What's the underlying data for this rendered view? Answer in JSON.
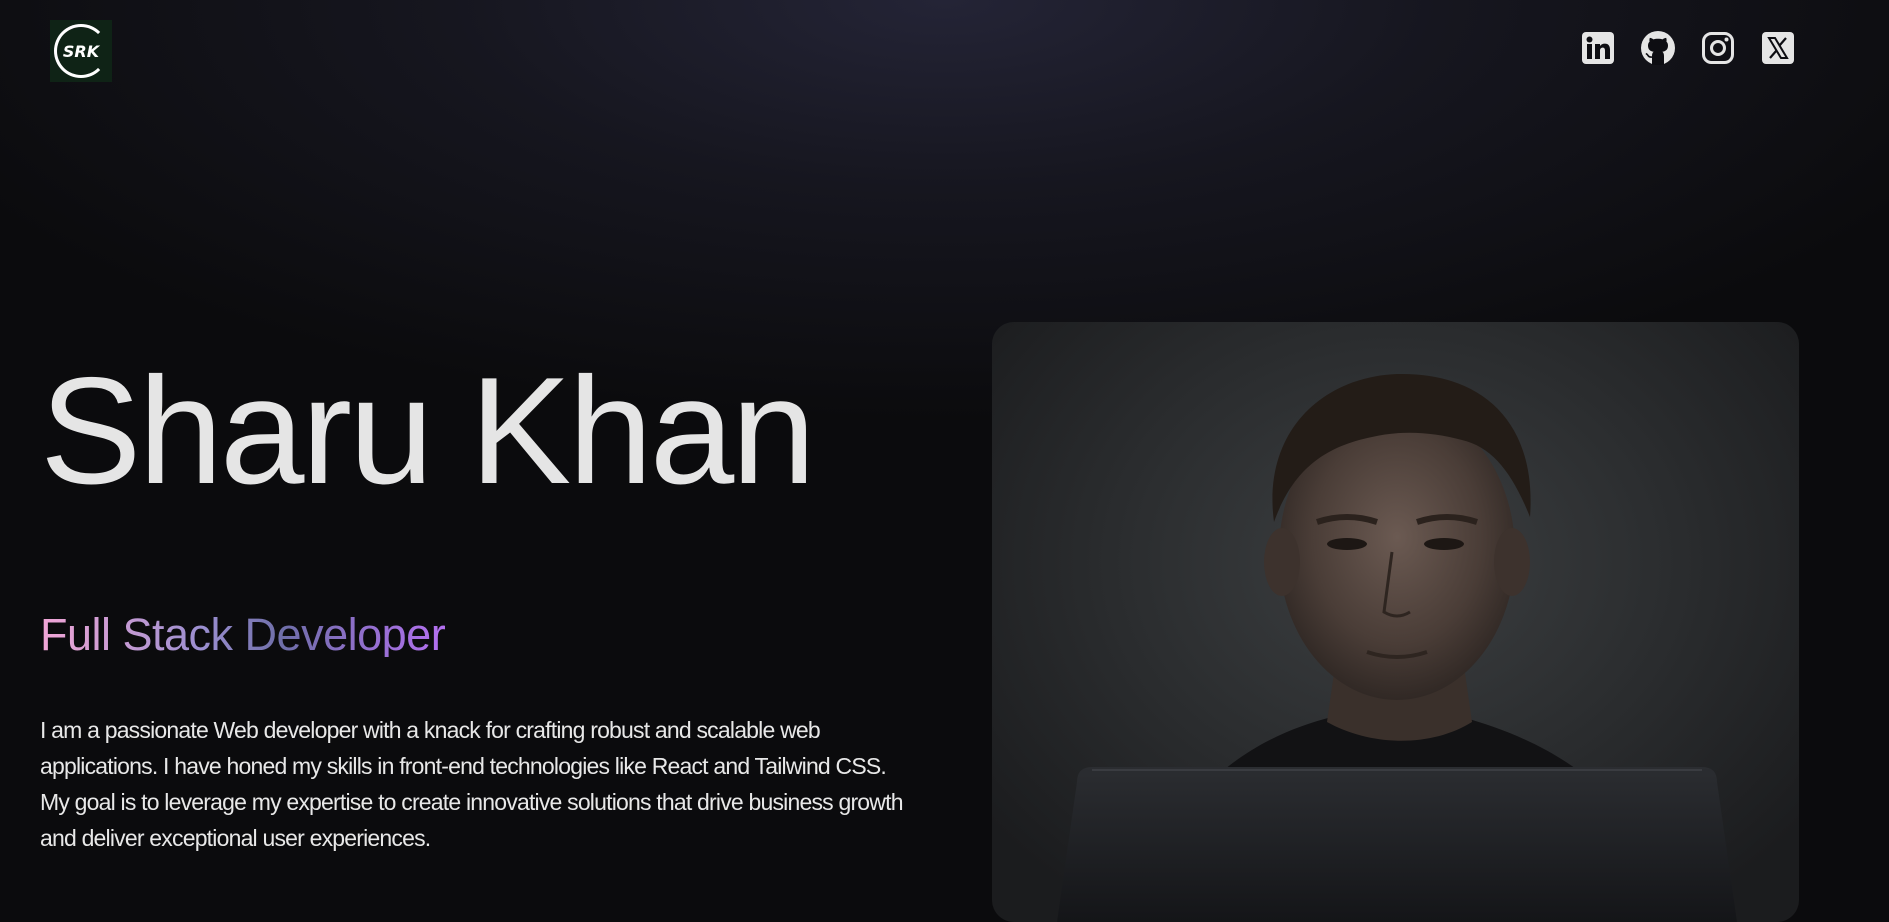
{
  "brand": {
    "logo_text": "SRK"
  },
  "nav": {
    "social_links": [
      {
        "name": "linkedin-icon"
      },
      {
        "name": "github-icon"
      },
      {
        "name": "instagram-icon"
      },
      {
        "name": "x-twitter-icon"
      }
    ]
  },
  "hero": {
    "name": "Sharu Khan",
    "role": "Full Stack Developer",
    "bio": "I am a passionate Web developer with a knack for crafting robust and scalable web applications. I have honed my skills in front-end technologies like React and Tailwind CSS. My goal is to leverage my expertise to create innovative solutions that drive business growth and deliver exceptional user experiences."
  },
  "colors": {
    "background": "#0b0b0d",
    "name_text": "#e5e5e5",
    "role_gradient_start": "#f2a6d6",
    "role_gradient_end": "#b470f0",
    "icon": "#e5e5e5"
  }
}
